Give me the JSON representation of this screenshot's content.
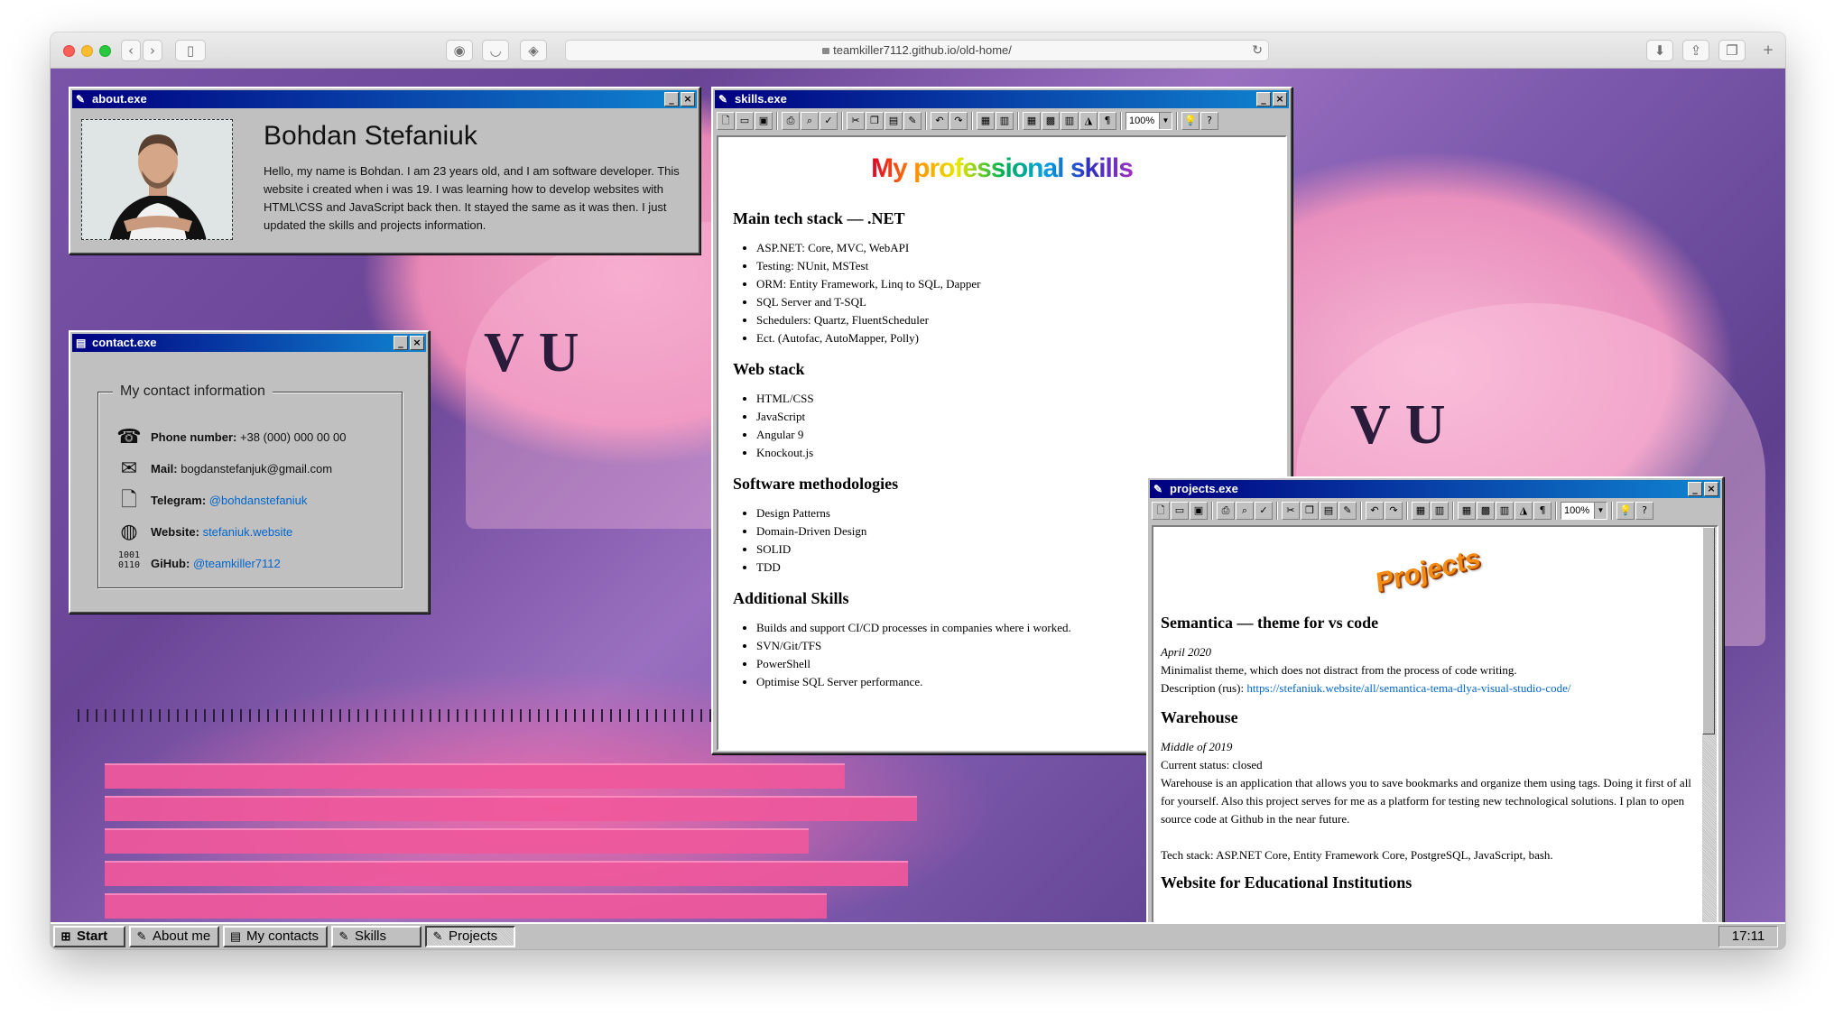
{
  "browser": {
    "url": "teamkiller7112.github.io/old-home/"
  },
  "about": {
    "title": "about.exe",
    "name": "Bohdan Stefaniuk",
    "text": "Hello, my name is Bohdan. I am 23 years old, and I am software developer. This website i created when i was 19. I was learning how to develop websites with HTML\\CSS and JavaScript back then. It stayed the same as it was then. I just updated the skills and projects information."
  },
  "contact": {
    "title": "contact.exe",
    "legend": "My contact information",
    "rows": [
      {
        "label": "Phone number:",
        "value": "+38 (000) 000 00 00",
        "icon": "phone-icon"
      },
      {
        "label": "Mail:",
        "value": "bogdanstefanjuk@gmail.com",
        "icon": "mail-icon"
      },
      {
        "label": "Telegram:",
        "value": "@bohdanstefaniuk",
        "icon": "document-icon"
      },
      {
        "label": "Website:",
        "value": "stefaniuk.website",
        "icon": "globe-icon"
      },
      {
        "label": "GiHub:",
        "value": "@teamkiller7112",
        "icon": "binary-icon"
      }
    ]
  },
  "skills": {
    "title": "skills.exe",
    "zoom": "100%",
    "heading": "My professional skills",
    "sections": [
      {
        "title": "Main tech stack — .NET",
        "items": [
          "ASP.NET: Core, MVC, WebAPI",
          "Testing: NUnit, MSTest",
          "ORM: Entity Framework, Linq to SQL, Dapper",
          "SQL Server and T-SQL",
          "Schedulers: Quartz, FluentScheduler",
          "Ect. (Autofac, AutoMapper, Polly)"
        ]
      },
      {
        "title": "Web stack",
        "items": [
          "HTML/CSS",
          "JavaScript",
          "Angular 9",
          "Knockout.js"
        ]
      },
      {
        "title": "Software methodologies",
        "items": [
          "Design Patterns",
          "Domain-Driven Design",
          "SOLID",
          "TDD"
        ]
      },
      {
        "title": "Additional Skills",
        "items": [
          "Builds and support CI/CD processes in companies where i worked.",
          "SVN/Git/TFS",
          "PowerShell",
          "Optimise SQL Server performance."
        ]
      }
    ]
  },
  "projects": {
    "title": "projects.exe",
    "zoom": "100%",
    "heading": "Projects",
    "p1": {
      "title": "Semantica — theme for vs code",
      "date": "April 2020",
      "desc": "Minimalist theme, which does not distract from the process of code writing.",
      "link_label": "Description (rus):",
      "link": "https://stefaniuk.website/all/semantica-tema-dlya-visual-studio-code/"
    },
    "p2": {
      "title": "Warehouse",
      "date": "Middle of 2019",
      "status": "Current status: closed",
      "desc": "Warehouse is an application that allows you to save bookmarks and organize them using tags. Doing it first of all for yourself. Also this project serves for me as a platform for testing new technological solutions. I plan to open source code at Github in the near future.",
      "stack": "Tech stack: ASP.NET Core, Entity Framework Core, PostgreSQL, JavaScript, bash."
    },
    "p3_partial": "Website for Educational Institutions"
  },
  "taskbar": {
    "start": "Start",
    "tasks": [
      "About me",
      "My contacts",
      "Skills",
      "Projects"
    ],
    "clock": "17:11"
  }
}
